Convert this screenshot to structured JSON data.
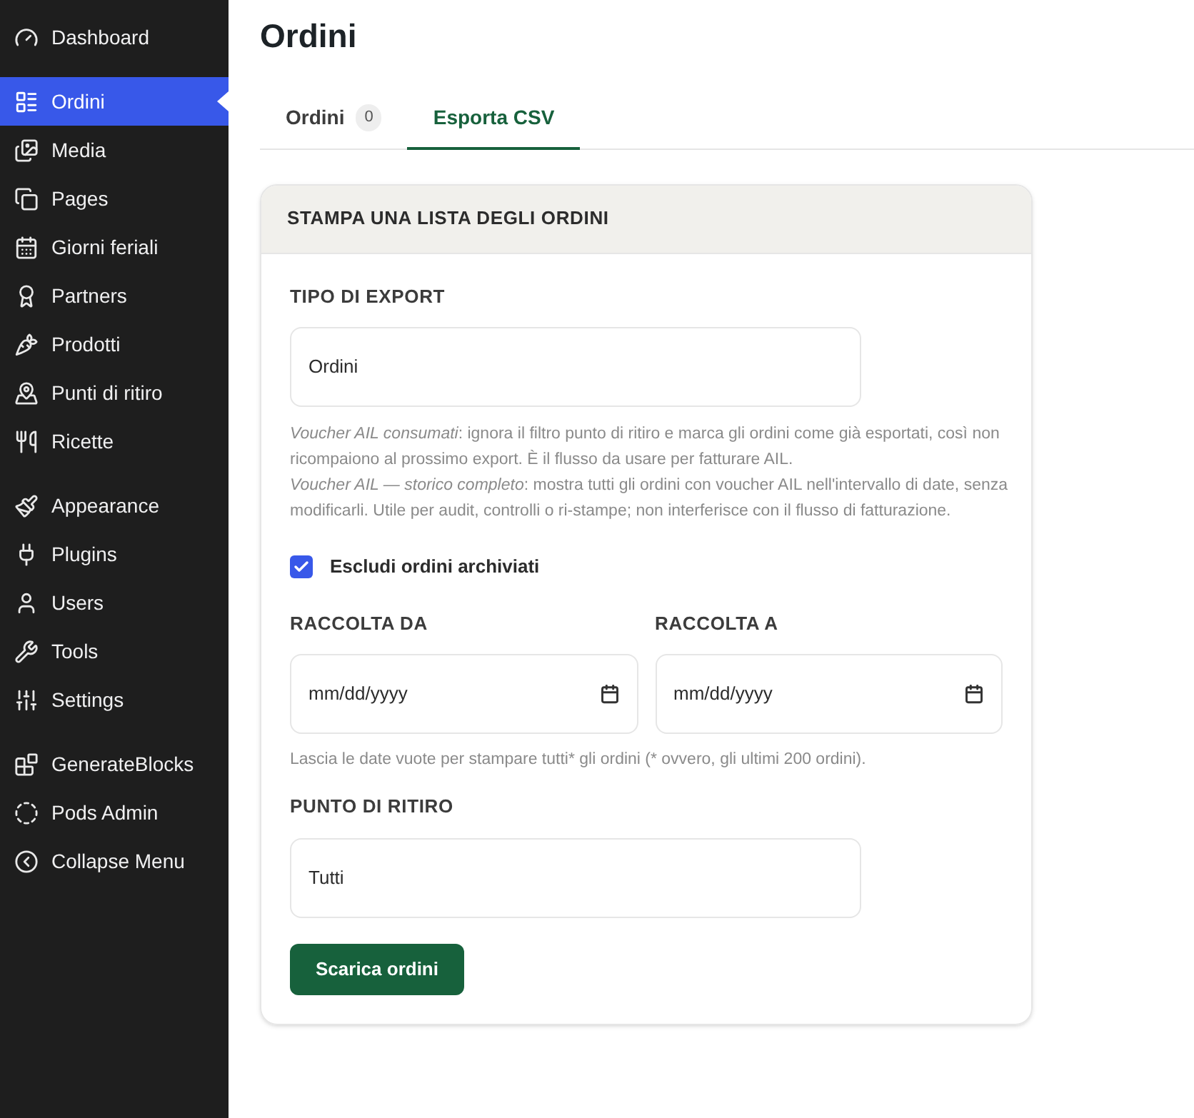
{
  "sidebar": {
    "groups": [
      [
        {
          "label": "Dashboard",
          "selected": false
        }
      ],
      [
        {
          "label": "Ordini",
          "selected": true
        },
        {
          "label": "Media",
          "selected": false
        },
        {
          "label": "Pages",
          "selected": false
        },
        {
          "label": "Giorni feriali",
          "selected": false
        },
        {
          "label": "Partners",
          "selected": false
        },
        {
          "label": "Prodotti",
          "selected": false
        },
        {
          "label": "Punti di ritiro",
          "selected": false
        },
        {
          "label": "Ricette",
          "selected": false
        }
      ],
      [
        {
          "label": "Appearance",
          "selected": false
        },
        {
          "label": "Plugins",
          "selected": false
        },
        {
          "label": "Users",
          "selected": false
        },
        {
          "label": "Tools",
          "selected": false
        },
        {
          "label": "Settings",
          "selected": false
        }
      ],
      [
        {
          "label": "GenerateBlocks",
          "selected": false
        },
        {
          "label": "Pods Admin",
          "selected": false
        },
        {
          "label": "Collapse Menu",
          "selected": false
        }
      ]
    ]
  },
  "page": {
    "title": "Ordini"
  },
  "tabs": [
    {
      "label": "Ordini",
      "count": "0",
      "selected": false
    },
    {
      "label": "Esporta CSV",
      "selected": true
    }
  ],
  "card": {
    "title": "STAMPA UNA LISTA DEGLI ORDINI",
    "export_type": {
      "label": "TIPO DI EXPORT",
      "value": "Ordini"
    },
    "help": [
      "*Voucher AIL consumati*: ignora il filtro punto di ritiro e marca gli ordini come già esportati, così non ricompaiono al prossimo export. È il flusso da usare per fatturare AIL.",
      "*Voucher AIL — storico completo*: mostra tutti gli ordini con voucher AIL nell'intervallo di date, senza modificarli. Utile per audit, controlli o ri-stampe; non interferisce con il flusso di fatturazione."
    ],
    "exclude_archived": {
      "label": "Escludi ordini archiviati",
      "checked": true
    },
    "date_from": {
      "label": "RACCOLTA DA",
      "placeholder": "mm/dd/yyyy"
    },
    "date_to": {
      "label": "RACCOLTA A",
      "placeholder": "mm/dd/yyyy"
    },
    "date_hint": "Lascia le date vuote per stampare tutti* gli ordini (* ovvero, gli ultimi 200 ordini).",
    "pickup_point": {
      "label": "PUNTO DI RITIRO",
      "value": "Tutti"
    },
    "submit": "Scarica ordini"
  }
}
